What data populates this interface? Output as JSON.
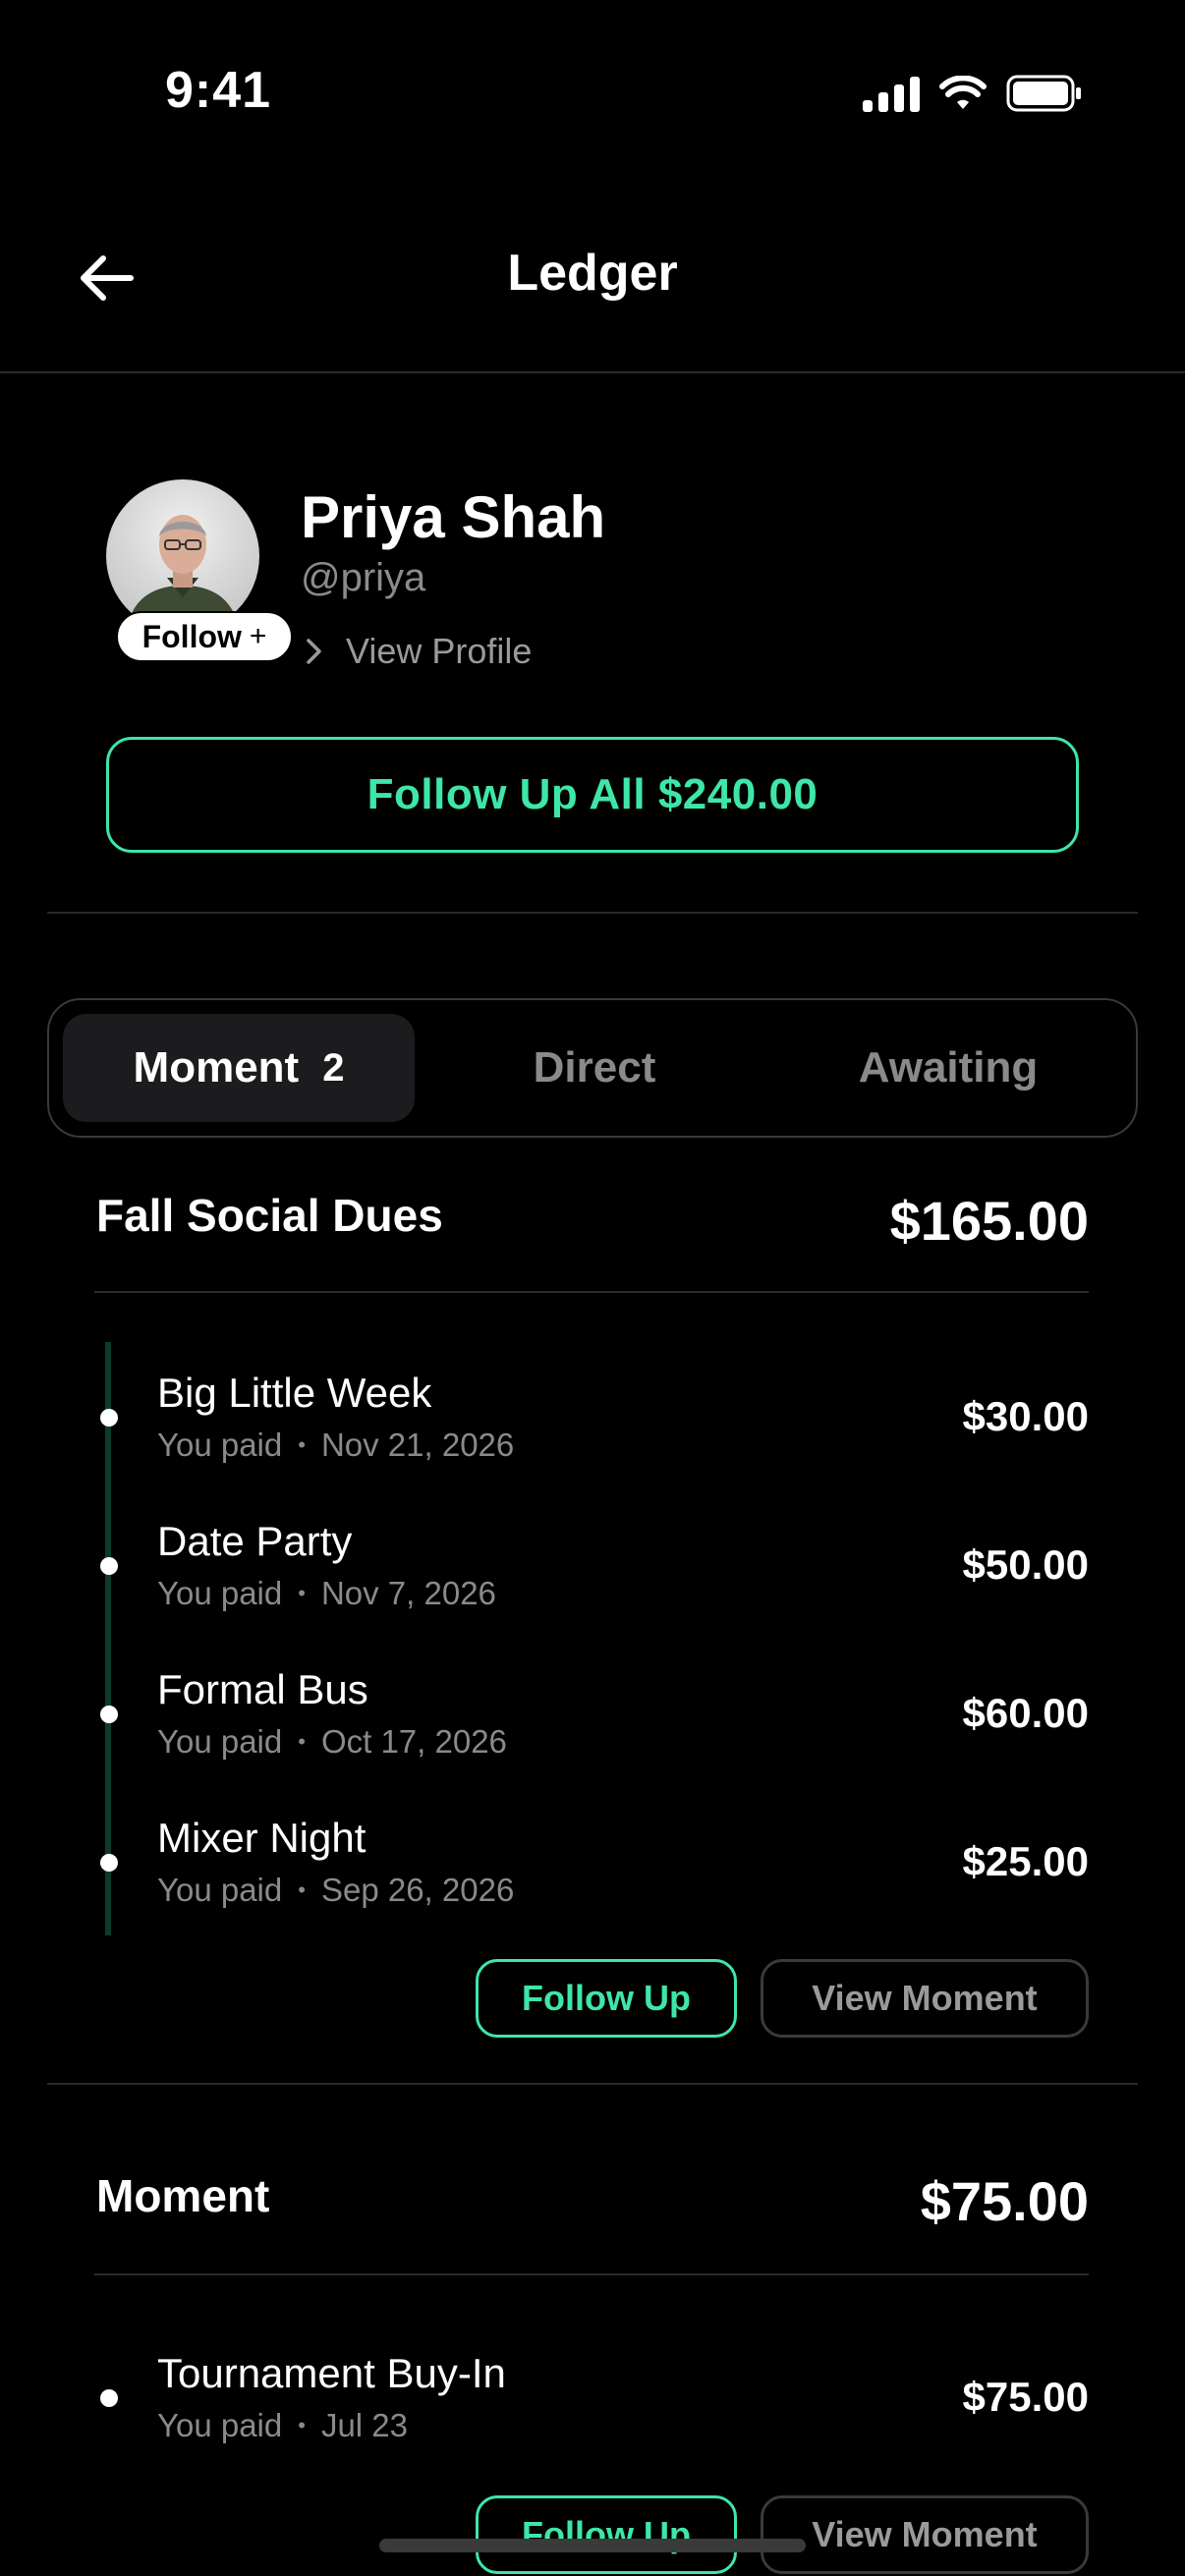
{
  "status_bar": {
    "time": "9:41"
  },
  "nav": {
    "title": "Ledger"
  },
  "profile": {
    "name": "Priya Shah",
    "handle": "@priya",
    "follow_label": "Follow",
    "follow_plus": "+",
    "view_profile": "View Profile"
  },
  "follow_all_label": "Follow Up All $240.00",
  "tabs": [
    {
      "label": "Moment",
      "count": "2",
      "active": true
    },
    {
      "label": "Direct",
      "count": "",
      "active": false
    },
    {
      "label": "Awaiting",
      "count": "",
      "active": false
    }
  ],
  "sections": [
    {
      "title": "Fall Social Dues",
      "total": "$165.00",
      "items": [
        {
          "title": "Big Little Week",
          "payer": "You paid",
          "date": "Nov 21, 2026",
          "amount": "$30.00"
        },
        {
          "title": "Date Party",
          "payer": "You paid",
          "date": "Nov 7, 2026",
          "amount": "$50.00"
        },
        {
          "title": "Formal Bus",
          "payer": "You paid",
          "date": "Oct 17, 2026",
          "amount": "$60.00"
        },
        {
          "title": "Mixer Night",
          "payer": "You paid",
          "date": "Sep 26, 2026",
          "amount": "$25.00"
        }
      ],
      "follow_up_label": "Follow Up",
      "view_label": "View Moment"
    },
    {
      "title": "Moment",
      "total": "$75.00",
      "items": [
        {
          "title": "Tournament Buy-In",
          "payer": "You paid",
          "date": "Jul 23",
          "amount": "$75.00"
        }
      ],
      "follow_up_label": "Follow Up",
      "view_label": "View Moment"
    }
  ],
  "colors": {
    "accent": "#3ee6a8",
    "background": "#000000",
    "muted": "#8a8a8a"
  }
}
